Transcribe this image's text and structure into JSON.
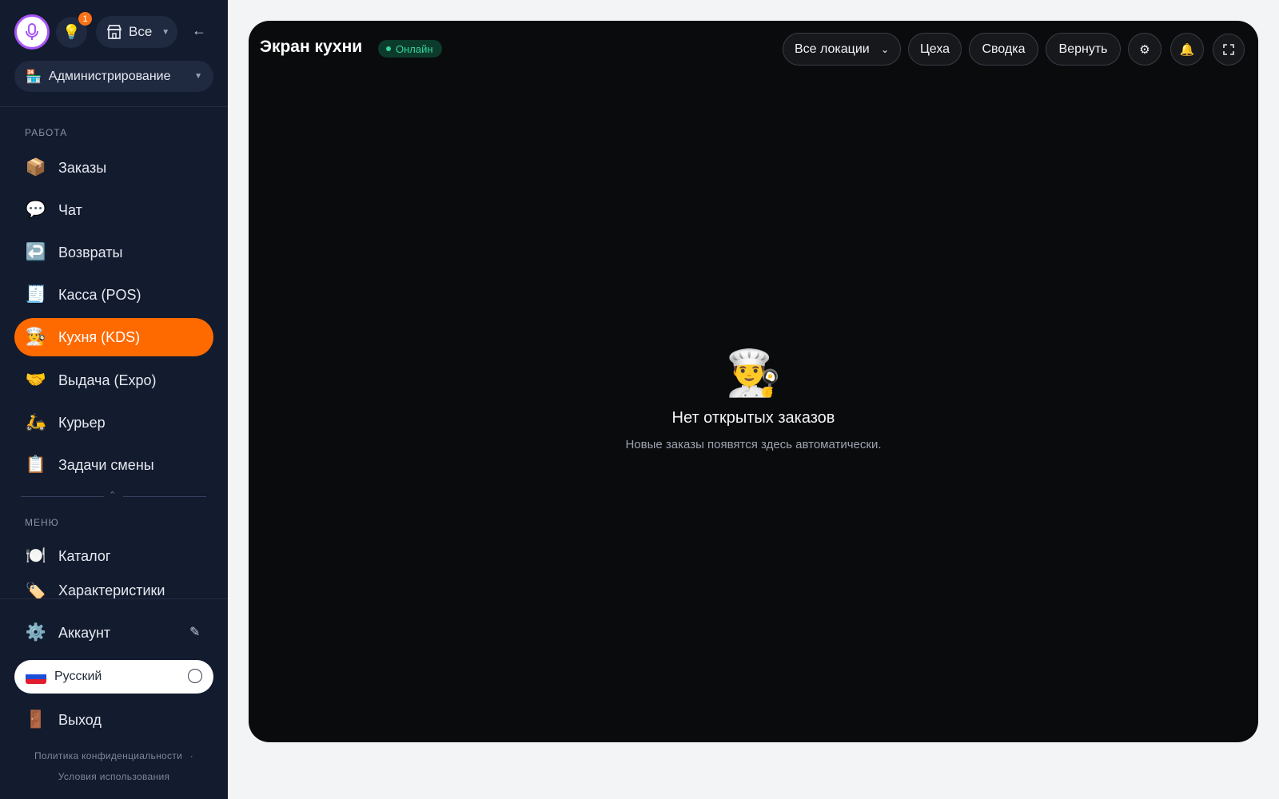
{
  "sidebar": {
    "notification_count": "1",
    "store_label": "Все",
    "admin_label": "Администрирование",
    "sections": {
      "work": "РАБОТА",
      "menu": "МЕНЮ"
    },
    "items": [
      {
        "icon": "📦",
        "label": "Заказы"
      },
      {
        "icon": "💬",
        "label": "Чат"
      },
      {
        "icon": "↩️",
        "label": "Возвраты"
      },
      {
        "icon": "🧾",
        "label": "Касса (POS)"
      },
      {
        "icon": "👨‍🍳",
        "label": "Кухня (KDS)"
      },
      {
        "icon": "🤝",
        "label": "Выдача (Expo)"
      },
      {
        "icon": "🛵",
        "label": "Курьер"
      },
      {
        "icon": "📋",
        "label": "Задачи смены"
      }
    ],
    "menu_items": [
      {
        "icon": "🍽️",
        "label": "Каталог"
      },
      {
        "icon": "🏷️",
        "label": "Характеристики"
      }
    ],
    "account": {
      "icon": "⚙️",
      "label": "Аккаунт"
    },
    "language": "Русский",
    "logout": {
      "icon": "🚪",
      "label": "Выход"
    },
    "footer": {
      "privacy": "Политика конфиденциальности",
      "separator": "·",
      "terms": "Условия использования"
    },
    "colors": {
      "active": "#ff6a00",
      "mic_ring": "#a855f7"
    }
  },
  "main": {
    "title": "Экран кухни",
    "status": "Онлайн",
    "location_select": "Все локации",
    "buttons": {
      "stations": "Цеха",
      "summary": "Сводка",
      "undo": "Вернуть"
    },
    "empty": {
      "icon": "👨‍🍳",
      "title": "Нет открытых заказов",
      "subtitle": "Новые заказы появятся здесь автоматически."
    }
  }
}
